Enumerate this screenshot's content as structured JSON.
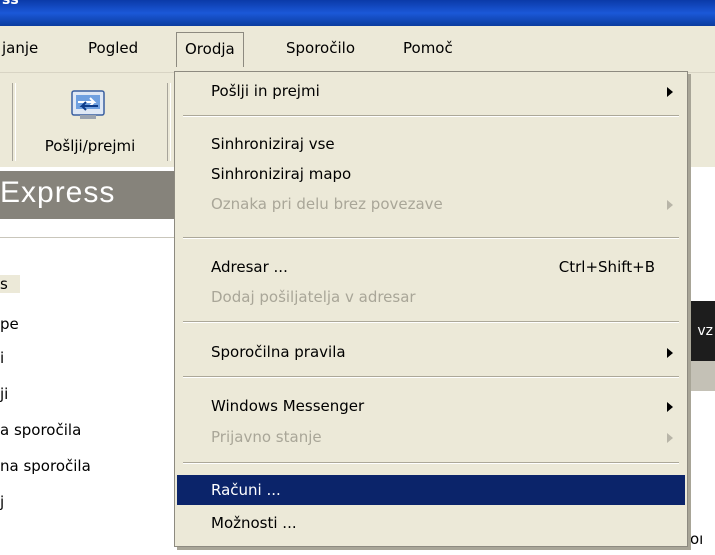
{
  "window": {
    "title_fragment": "ss"
  },
  "menubar": {
    "items": [
      "janje",
      "Pogled",
      "Orodja",
      "Sporočilo",
      "Pomoč"
    ],
    "active": "Orodja"
  },
  "toolbar": {
    "send_receive_label": "Pošlji/prejmi",
    "send_icon": "send-receive-icon"
  },
  "banner": {
    "title": "Express"
  },
  "folders": [
    "s",
    "pe",
    "i",
    "ji",
    "a sporočila",
    "na sporočila",
    "j"
  ],
  "right_pane": {
    "dark_text": "vz",
    "bottom_text": "oı"
  },
  "dropdown": {
    "items": [
      {
        "label": "Pošlji in prejmi",
        "shortcut": "",
        "submenu": true,
        "disabled": false
      },
      {
        "label": "Sinhroniziraj vse",
        "shortcut": "",
        "submenu": false,
        "disabled": false
      },
      {
        "label": "Sinhroniziraj mapo",
        "shortcut": "",
        "submenu": false,
        "disabled": false
      },
      {
        "label": "Oznaka pri delu brez povezave",
        "shortcut": "",
        "submenu": true,
        "disabled": true
      },
      {
        "label": "Adresar ...",
        "shortcut": "Ctrl+Shift+B",
        "submenu": false,
        "disabled": false
      },
      {
        "label": "Dodaj pošiljatelja v adresar",
        "shortcut": "",
        "submenu": false,
        "disabled": true
      },
      {
        "label": "Sporočilna pravila",
        "shortcut": "",
        "submenu": true,
        "disabled": false
      },
      {
        "label": "Windows Messenger",
        "shortcut": "",
        "submenu": true,
        "disabled": false
      },
      {
        "label": "Prijavno stanje",
        "shortcut": "",
        "submenu": true,
        "disabled": true
      },
      {
        "label": "Računi ...",
        "shortcut": "",
        "submenu": false,
        "disabled": false,
        "selected": true
      },
      {
        "label": "Možnosti ...",
        "shortcut": "",
        "submenu": false,
        "disabled": false
      }
    ]
  },
  "colors": {
    "menu_bg": "#ece9d8",
    "highlight": "#0b246a",
    "disabled_text": "#a9a698",
    "titlebar": "#1b58d8"
  }
}
